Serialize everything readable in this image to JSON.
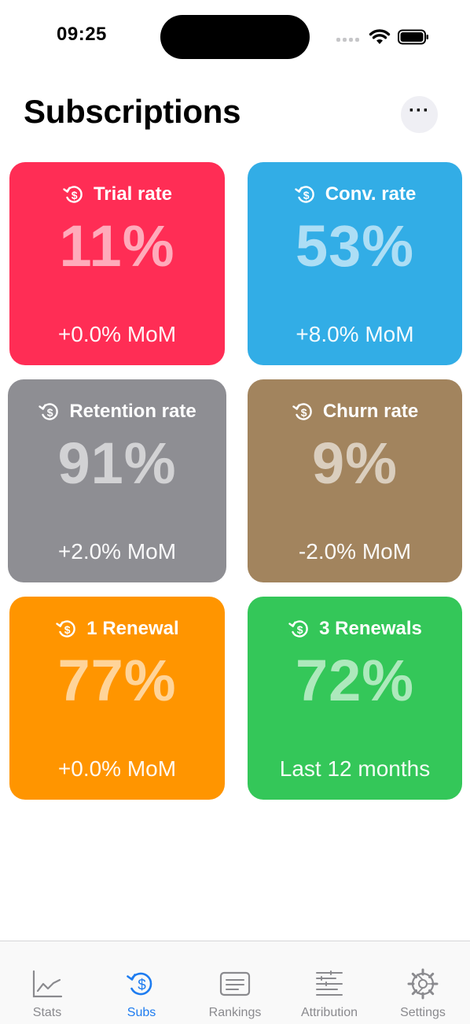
{
  "status_bar": {
    "time": "09:25"
  },
  "header": {
    "title": "Subscriptions",
    "more_label": "···"
  },
  "colors": {
    "trial": "#ff2d55",
    "conversion": "#32ade6",
    "retention": "#8e8e93",
    "churn": "#a2845e",
    "renewal_1": "#ff9500",
    "renewal_3": "#34c759",
    "active_tab": "#1e7cf0",
    "inactive_tab": "#8a8a8e"
  },
  "cards": [
    {
      "title": "Trial rate",
      "value": "11%",
      "footer": "+0.0% MoM",
      "icon": "refresh-dollar-icon"
    },
    {
      "title": "Conv. rate",
      "value": "53%",
      "footer": "+8.0% MoM",
      "icon": "refresh-dollar-icon"
    },
    {
      "title": "Retention rate",
      "value": "91%",
      "footer": "+2.0% MoM",
      "icon": "refresh-dollar-icon"
    },
    {
      "title": "Churn rate",
      "value": "9%",
      "footer": "-2.0% MoM",
      "icon": "refresh-dollar-icon"
    },
    {
      "title": "1 Renewal",
      "value": "77%",
      "footer": "+0.0% MoM",
      "icon": "refresh-dollar-icon"
    },
    {
      "title": "3 Renewals",
      "value": "72%",
      "footer": "Last 12 months",
      "icon": "refresh-dollar-icon"
    }
  ],
  "tabs": [
    {
      "label": "Stats",
      "icon": "line-chart-icon",
      "active": false
    },
    {
      "label": "Subs",
      "icon": "refresh-dollar-icon",
      "active": true
    },
    {
      "label": "Rankings",
      "icon": "list-card-icon",
      "active": false
    },
    {
      "label": "Attribution",
      "icon": "bars-list-icon",
      "active": false
    },
    {
      "label": "Settings",
      "icon": "gear-icon",
      "active": false
    }
  ]
}
